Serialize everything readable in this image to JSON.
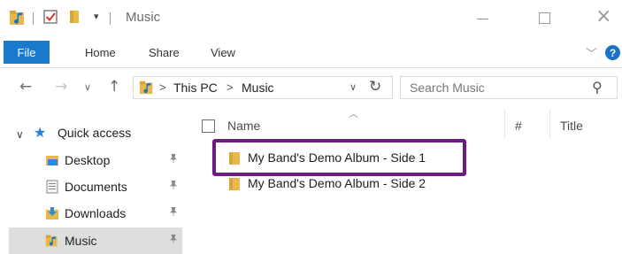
{
  "window": {
    "title": "Music",
    "controls": {
      "minimize_icon": "minimize-icon",
      "maximize_icon": "maximize-icon",
      "close_icon": "close-icon",
      "close_glyph": "×"
    }
  },
  "ribbon": {
    "tabs": [
      "File",
      "Home",
      "Share",
      "View"
    ],
    "help_glyph": "?"
  },
  "navigation": {
    "breadcrumb": [
      "This PC",
      "Music"
    ],
    "separator": ">",
    "search_placeholder": "Search Music"
  },
  "nav_pane": {
    "quick_access": "Quick access",
    "items": [
      {
        "label": "Desktop",
        "icon": "desktop-folder-icon",
        "pinned": true
      },
      {
        "label": "Documents",
        "icon": "documents-folder-icon",
        "pinned": true
      },
      {
        "label": "Downloads",
        "icon": "downloads-folder-icon",
        "pinned": true
      },
      {
        "label": "Music",
        "icon": "music-folder-icon",
        "pinned": true,
        "selected": true
      }
    ]
  },
  "file_list": {
    "columns": [
      "Name",
      "#",
      "Title"
    ],
    "rows": [
      {
        "name": "My Band's Demo Album - Side 1",
        "icon": "folder-icon",
        "highlighted": true
      },
      {
        "name": "My Band's Demo Album - Side 2",
        "icon": "folder-icon",
        "highlighted": false
      }
    ]
  },
  "colors": {
    "accent": "#1979ca",
    "highlight_box": "#6c1c80",
    "folder": "#e8b94a",
    "selection": "#dedede"
  }
}
